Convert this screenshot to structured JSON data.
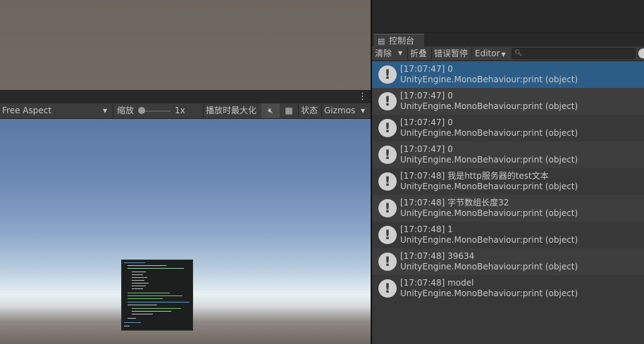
{
  "game_toolbar": {
    "aspect": "Free Aspect",
    "scale_label": "缩放",
    "scale_value": "1x",
    "maximize_label": "播放时最大化",
    "status_label": "状态",
    "gizmos_label": "Gizmos"
  },
  "console": {
    "tab_label": "控制台",
    "toolbar": {
      "clear_label": "清除",
      "collapse_label": "折叠",
      "error_pause_label": "错误暂停",
      "editor_label": "Editor"
    },
    "search": {
      "value": "",
      "placeholder": ""
    },
    "logs": [
      {
        "line1": "[17:07:47] 0",
        "line2": "UnityEngine.MonoBehaviour:print (object)",
        "selected": true
      },
      {
        "line1": "[17:07:47] 0",
        "line2": "UnityEngine.MonoBehaviour:print (object)"
      },
      {
        "line1": "[17:07:47] 0",
        "line2": "UnityEngine.MonoBehaviour:print (object)"
      },
      {
        "line1": "[17:07:47] 0",
        "line2": "UnityEngine.MonoBehaviour:print (object)"
      },
      {
        "line1": "[17:07:48] 我是http服务器的test文本",
        "line2": "UnityEngine.MonoBehaviour:print (object)"
      },
      {
        "line1": "[17:07:48] 字节数组长度32",
        "line2": "UnityEngine.MonoBehaviour:print (object)"
      },
      {
        "line1": "[17:07:48] 1",
        "line2": "UnityEngine.MonoBehaviour:print (object)"
      },
      {
        "line1": "[17:07:48] 39634",
        "line2": "UnityEngine.MonoBehaviour:print (object)"
      },
      {
        "line1": "[17:07:48] model",
        "line2": "UnityEngine.MonoBehaviour:print (object)"
      }
    ]
  },
  "colors": {
    "selected_row": "#2c5d87",
    "panel_bg": "#383838",
    "toolbar_bg": "#3c3c3c"
  },
  "icons": [
    "more-vertical-icon",
    "dropdown-arrow-icon",
    "mute-audio-icon",
    "stats-grid-icon",
    "console-icon",
    "search-icon",
    "info-icon"
  ]
}
